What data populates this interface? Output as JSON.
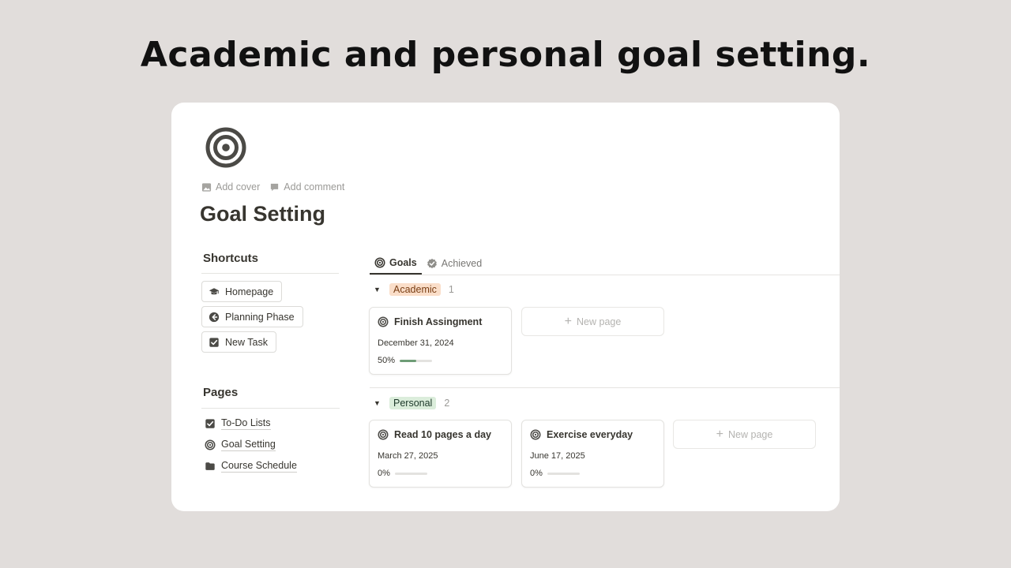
{
  "headline": "Academic and personal goal setting.",
  "page": {
    "icon": "target-icon",
    "add_cover": "Add cover",
    "add_comment": "Add comment",
    "title": "Goal Setting"
  },
  "sidebar": {
    "shortcuts_heading": "Shortcuts",
    "shortcuts": [
      {
        "label": "Homepage",
        "icon": "graduation-cap-icon"
      },
      {
        "label": "Planning Phase",
        "icon": "arrow-left-circle-icon"
      },
      {
        "label": "New Task",
        "icon": "checkbox-icon"
      }
    ],
    "pages_heading": "Pages",
    "pages": [
      {
        "label": "To-Do Lists",
        "icon": "checkbox-icon"
      },
      {
        "label": "Goal Setting",
        "icon": "target-icon"
      },
      {
        "label": "Course Schedule",
        "icon": "folder-icon"
      }
    ]
  },
  "tabs": [
    {
      "label": "Goals",
      "icon": "target-icon",
      "active": true
    },
    {
      "label": "Achieved",
      "icon": "check-badge-icon",
      "active": false
    }
  ],
  "groups": [
    {
      "name": "Academic",
      "count": "1",
      "color": "#fadec9",
      "cards": [
        {
          "title": "Finish Assingment",
          "date": "December 31, 2024",
          "progress_label": "50%",
          "progress": 0.5
        }
      ],
      "new_page": "New page"
    },
    {
      "name": "Personal",
      "count": "2",
      "color": "#dbeddb",
      "cards": [
        {
          "title": "Read 10 pages a day",
          "date": "March 27, 2025",
          "progress_label": "0%",
          "progress": 0
        },
        {
          "title": "Exercise everyday",
          "date": "June 17, 2025",
          "progress_label": "0%",
          "progress": 0
        }
      ],
      "new_page": "New page"
    }
  ],
  "colors": {
    "background": "#e1dddb",
    "progress_fill": "#6e9c76"
  }
}
